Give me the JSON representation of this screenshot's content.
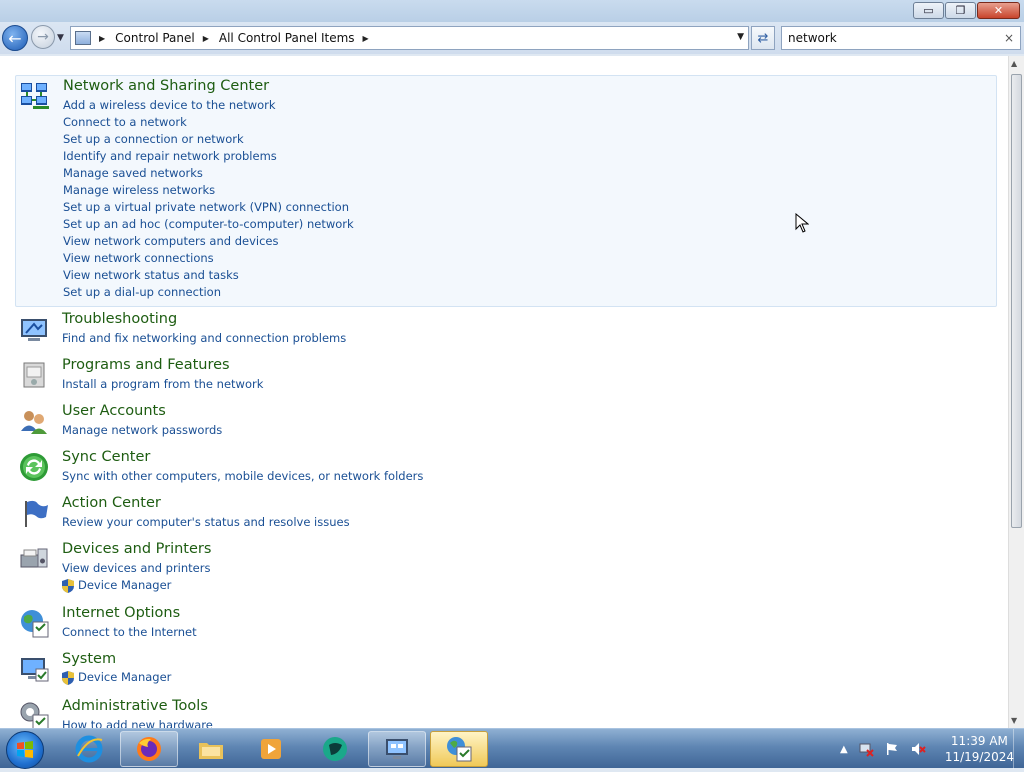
{
  "window": {
    "controls": {
      "minimize": "▭",
      "restore": "❐",
      "close": "✕"
    }
  },
  "address": {
    "crumbs": [
      "Control Panel",
      "All Control Panel Items"
    ],
    "separator": "▶"
  },
  "search": {
    "value": "network",
    "clear": "×"
  },
  "results": [
    {
      "title": "Network and Sharing Center",
      "icon": "network-sharing-icon",
      "links": [
        "Add a wireless device to the network",
        "Connect to a network",
        "Set up a connection or network",
        "Identify and repair network problems",
        "Manage saved networks",
        "Manage wireless networks",
        "Set up a virtual private network (VPN) connection",
        "Set up an ad hoc (computer-to-computer) network",
        "View network computers and devices",
        "View network connections",
        "View network status and tasks",
        "Set up a dial-up connection"
      ]
    },
    {
      "title": "Troubleshooting",
      "icon": "troubleshooting-icon",
      "links": [
        "Find and fix networking and connection problems"
      ]
    },
    {
      "title": "Programs and Features",
      "icon": "programs-features-icon",
      "links": [
        "Install a program from the network"
      ]
    },
    {
      "title": "User Accounts",
      "icon": "user-accounts-icon",
      "links": [
        "Manage network passwords"
      ]
    },
    {
      "title": "Sync Center",
      "icon": "sync-center-icon",
      "links": [
        "Sync with other computers, mobile devices, or network folders"
      ]
    },
    {
      "title": "Action Center",
      "icon": "action-center-icon",
      "links": [
        "Review your computer's status and resolve issues"
      ]
    },
    {
      "title": "Devices and Printers",
      "icon": "devices-printers-icon",
      "links": [
        "View devices and printers"
      ],
      "shield_links": [
        "Device Manager"
      ]
    },
    {
      "title": "Internet Options",
      "icon": "internet-options-icon",
      "links": [
        "Connect to the Internet"
      ]
    },
    {
      "title": "System",
      "icon": "system-icon",
      "links": [],
      "shield_links": [
        "Device Manager"
      ]
    },
    {
      "title": "Administrative Tools",
      "icon": "administrative-tools-icon",
      "links": [
        "How to add new hardware"
      ]
    }
  ],
  "taskbar": {
    "items": [
      "internet-explorer-icon",
      "firefox-icon",
      "file-explorer-icon",
      "media-player-icon",
      "app-icon",
      "remote-desktop-icon",
      "control-panel-icon"
    ]
  },
  "clock": {
    "time": "11:39 AM",
    "date": "11/19/2024"
  }
}
